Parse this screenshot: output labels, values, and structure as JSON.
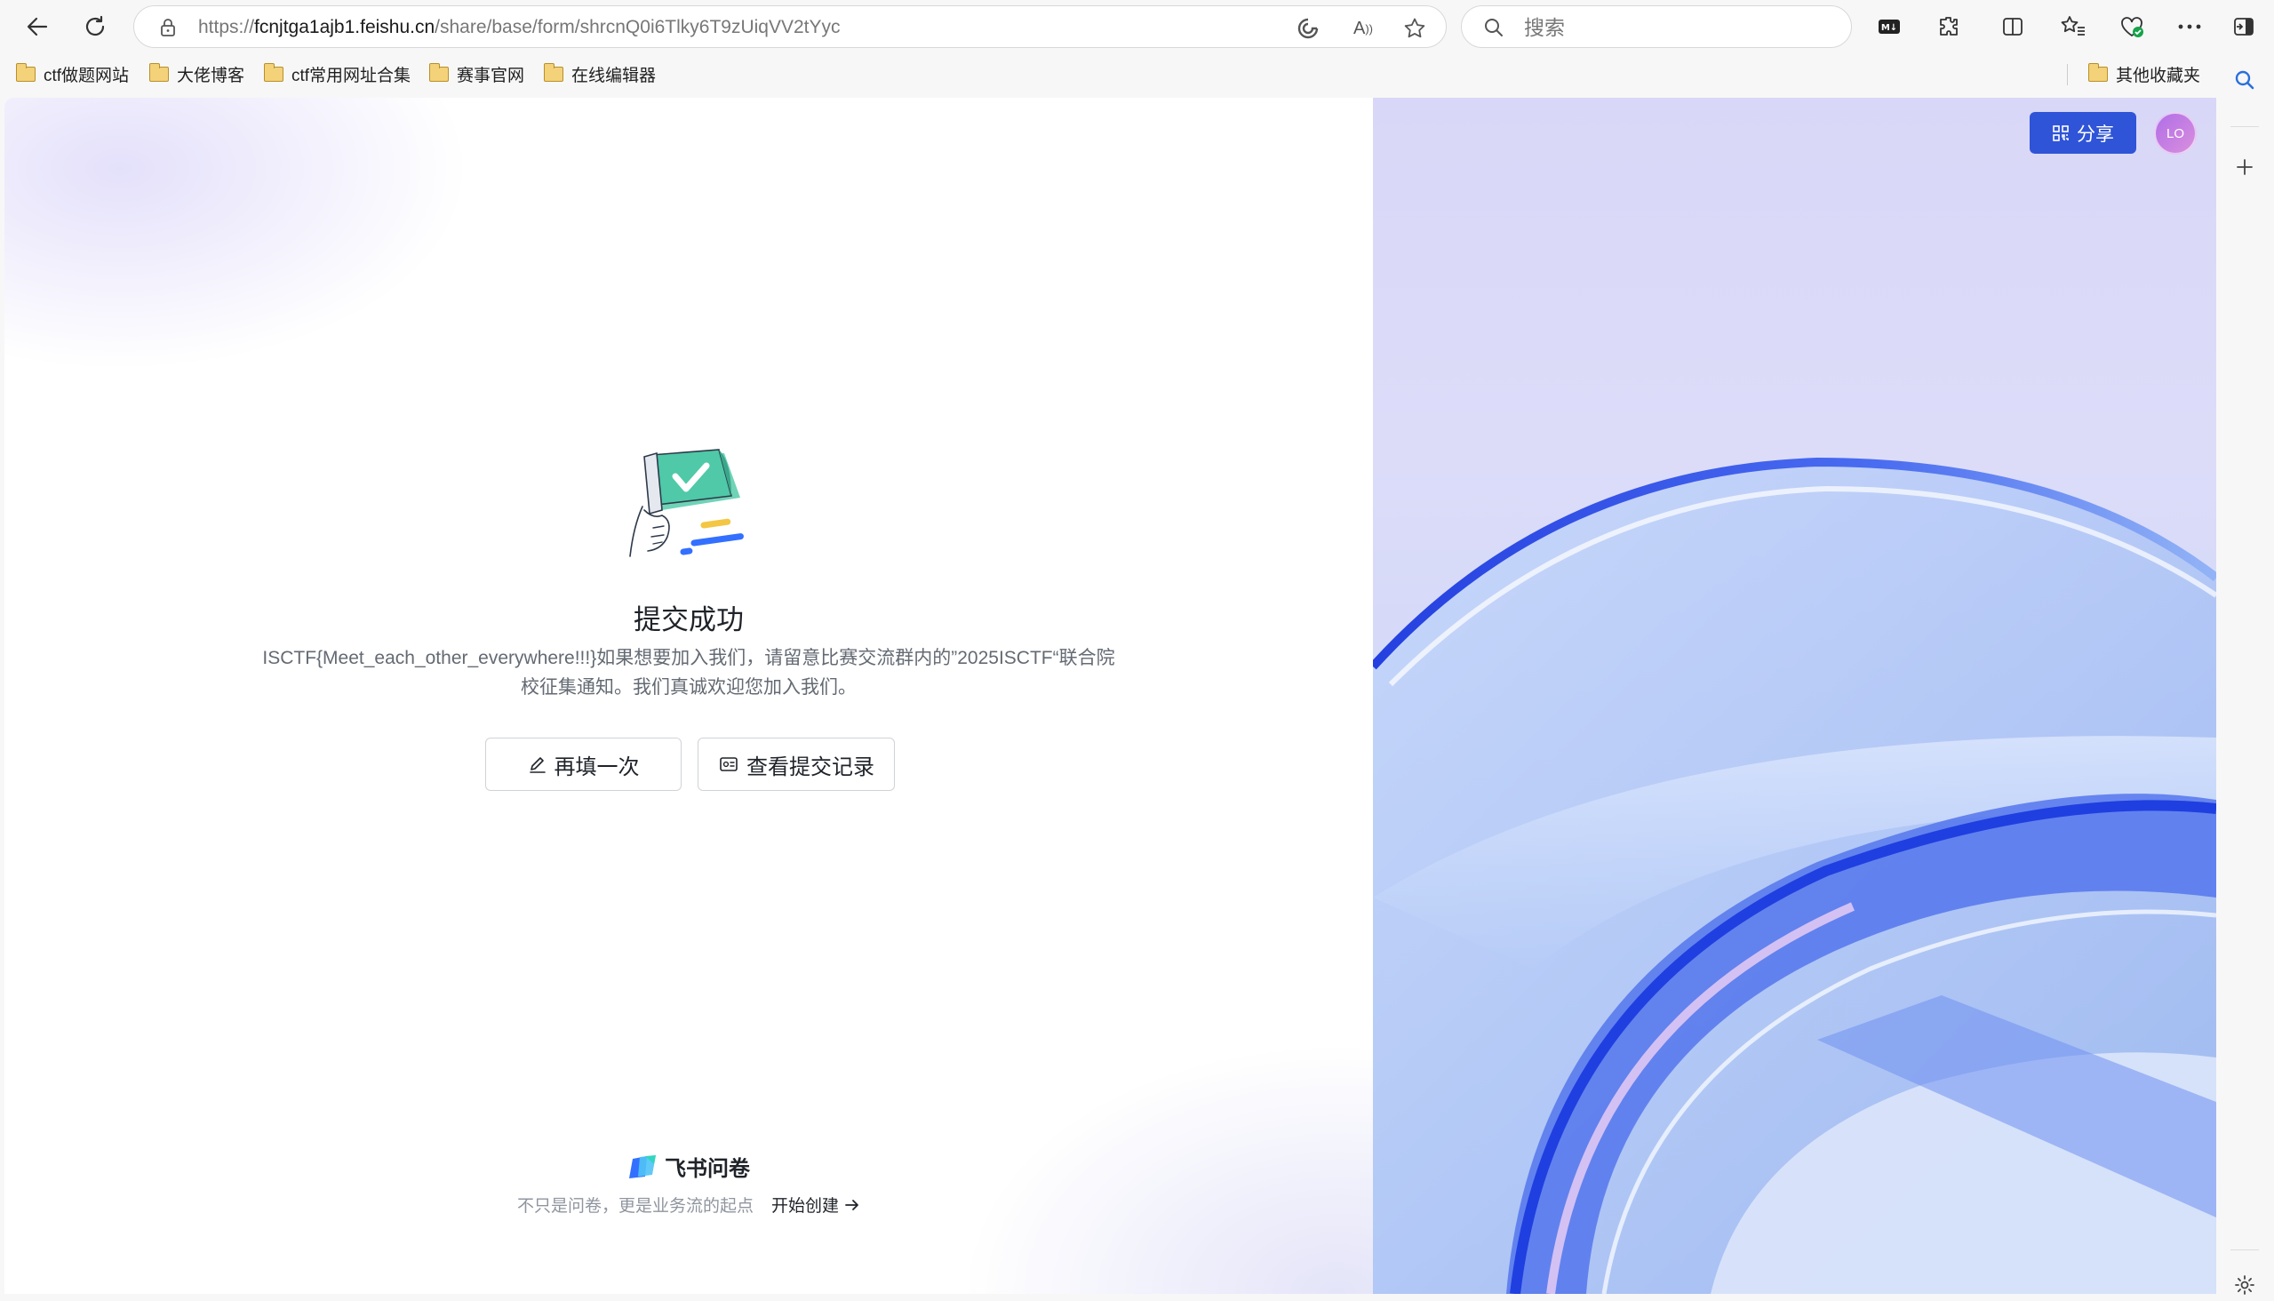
{
  "browser": {
    "url_prefix": "https://",
    "url_host": "fcnjtga1ajb1.feishu.cn",
    "url_path": "/share/base/form/shrcnQ0i6Tlky6T9zUiqVV2tYyc",
    "search_placeholder": "搜索"
  },
  "bookmarks": [
    {
      "label": "ctf做题网站"
    },
    {
      "label": "大佬博客"
    },
    {
      "label": "ctf常用网址合集"
    },
    {
      "label": "赛事官网"
    },
    {
      "label": "在线编辑器"
    }
  ],
  "other_bookmarks": "其他收藏夹",
  "header": {
    "share_label": "分享",
    "avatar_initials": "LO"
  },
  "result": {
    "title": "提交成功",
    "message": "ISCTF{Meet_each_other_everywhere!!!}如果想要加入我们，请留意比赛交流群内的”2025ISCTF“联合院校征集通知。我们真诚欢迎您加入我们。",
    "refill_label": "再填一次",
    "records_label": "查看提交记录"
  },
  "footer": {
    "brand": "飞书问卷",
    "slogan": "不只是问卷，更是业务流的起点",
    "create_label": "开始创建"
  },
  "colors": {
    "primary": "#2f54d8",
    "illustration_green": "#4fc9a7",
    "illustration_yellow": "#f3c744",
    "illustration_blue": "#3370ff"
  }
}
